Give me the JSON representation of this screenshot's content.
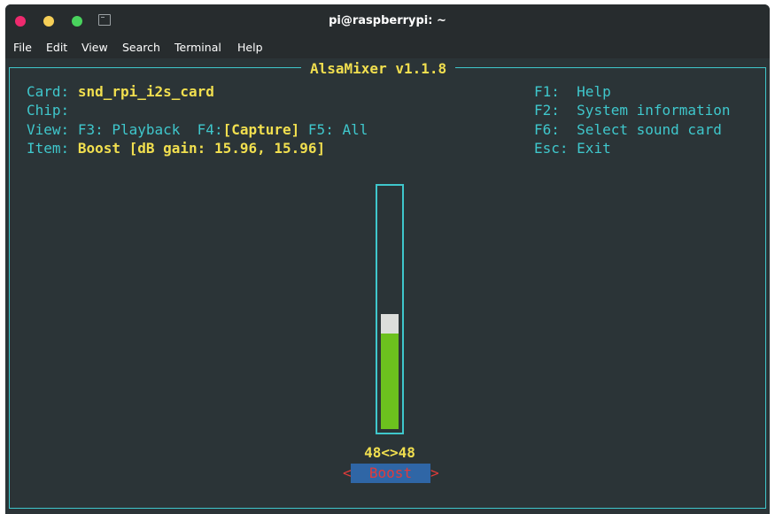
{
  "window": {
    "title": "pi@raspberrypi: ~"
  },
  "menu": [
    "File",
    "Edit",
    "View",
    "Search",
    "Terminal",
    "Help"
  ],
  "mixer": {
    "title": "AlsaMixer v1.1.8",
    "card_label": "Card:",
    "card_value": "snd_rpi_i2s_card",
    "chip_label": "Chip:",
    "view_label": "View:",
    "view_f3": "F3: Playback",
    "view_f4_key": "F4:",
    "view_f4_value": "[Capture]",
    "view_f5": "F5: All",
    "item_label": "Item:",
    "item_value": "Boost [dB gain: 15.96, 15.96]",
    "help_keys": [
      {
        "key": "F1:",
        "desc": "Help"
      },
      {
        "key": "F2:",
        "desc": "System information"
      },
      {
        "key": "F6:",
        "desc": "Select sound card"
      },
      {
        "key": "Esc:",
        "desc": "Exit"
      }
    ],
    "control": {
      "levels_text": "48<>48",
      "name": "Boost",
      "level_fraction": 0.48,
      "left_arrow": "<",
      "right_arrow": ">"
    }
  },
  "colors": {
    "cyan": "#3fc7cc",
    "yellow": "#f1df4f",
    "green": "#6cc11e",
    "selection_bg": "#2f66a6",
    "selection_text": "#e23b3b"
  }
}
